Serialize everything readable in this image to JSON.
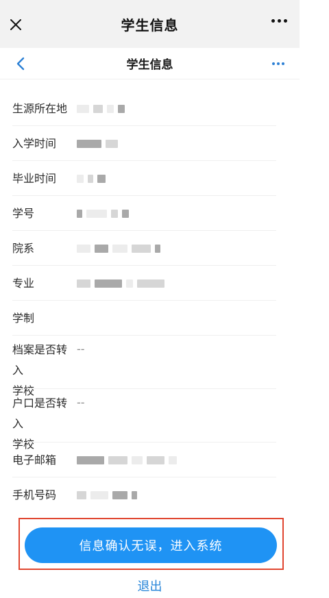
{
  "window": {
    "title": "学生信息",
    "close_icon": "close-icon",
    "more_icon": "more-icon"
  },
  "page": {
    "title": "学生信息",
    "back_icon": "chevron-left-icon",
    "more_icon": "more-icon",
    "accent_color": "#2b7fd4"
  },
  "fields": [
    {
      "label": "生源所在地",
      "value": ""
    },
    {
      "label": "入学时间",
      "value": ""
    },
    {
      "label": "毕业时间",
      "value": ""
    },
    {
      "label": "学号",
      "value": ""
    },
    {
      "label": "院系",
      "value": ""
    },
    {
      "label": "专业",
      "value": ""
    },
    {
      "label": "学制",
      "value": ""
    },
    {
      "label_line1": "档案是否转入",
      "label_line2": "学校",
      "value": "--"
    },
    {
      "label_line1": "户口是否转入",
      "label_line2": "学校",
      "value": "--"
    },
    {
      "label": "电子邮箱",
      "value": ""
    },
    {
      "label": "手机号码",
      "value": ""
    }
  ],
  "actions": {
    "confirm_label": "信息确认无误，进入系统",
    "confirm_color": "#1f93f4",
    "highlight_color": "#e0452f",
    "exit_label": "退出"
  }
}
